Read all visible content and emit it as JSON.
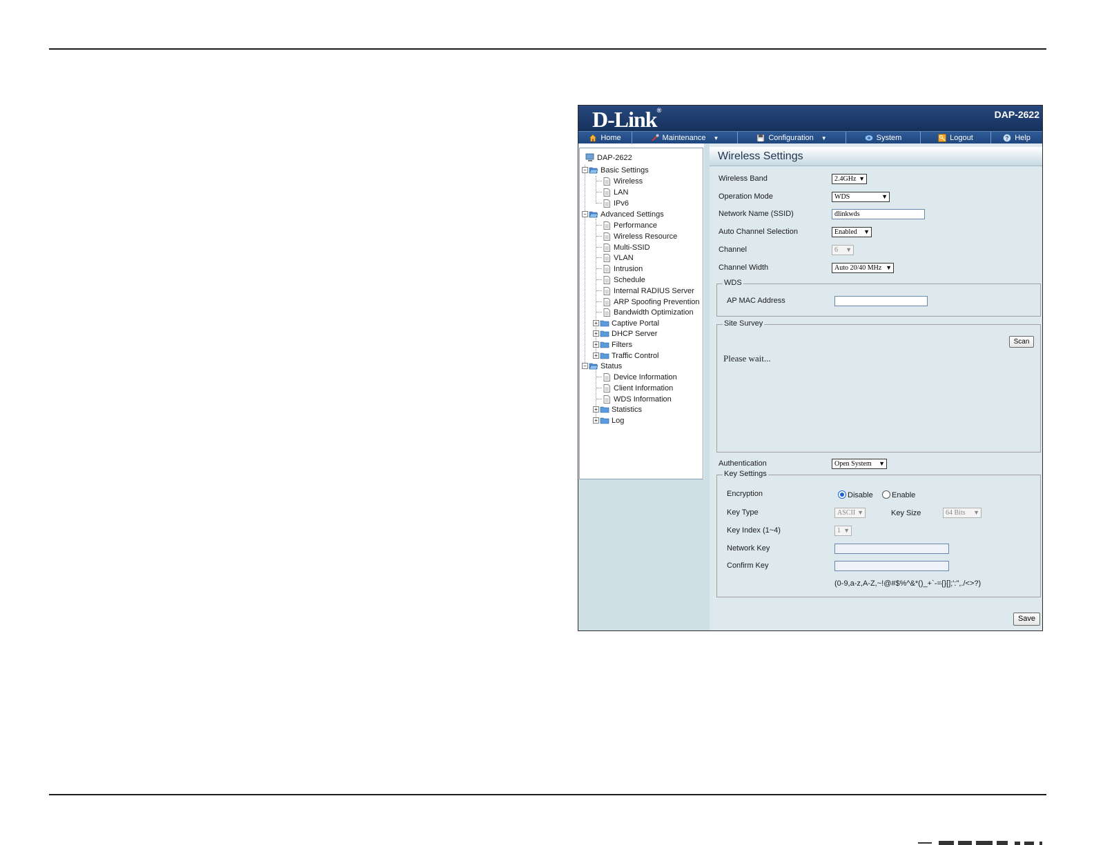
{
  "banner": {
    "logo_text": "D-Link",
    "logo_mark": "®",
    "model": "DAP-2622"
  },
  "nav": [
    {
      "label": "Home",
      "icon": "home-icon"
    },
    {
      "label": "Maintenance",
      "icon": "tools-icon"
    },
    {
      "label": "Configuration",
      "icon": "disk-icon"
    },
    {
      "label": "System",
      "icon": "system-icon"
    },
    {
      "label": "Logout",
      "icon": "key-icon"
    },
    {
      "label": "Help",
      "icon": "help-icon"
    }
  ],
  "tree": {
    "root": "DAP-2622",
    "basic": {
      "label": "Basic Settings",
      "items": [
        "Wireless",
        "LAN",
        "IPv6"
      ]
    },
    "advanced": {
      "label": "Advanced Settings",
      "items": [
        "Performance",
        "Wireless Resource",
        "Multi-SSID",
        "VLAN",
        "Intrusion",
        "Schedule",
        "Internal RADIUS Server",
        "ARP Spoofing Prevention",
        "Bandwidth Optimization"
      ],
      "folders": [
        "Captive Portal",
        "DHCP Server",
        "Filters",
        "Traffic Control"
      ]
    },
    "status": {
      "label": "Status",
      "items": [
        "Device Information",
        "Client Information",
        "WDS Information"
      ],
      "folders": [
        "Statistics",
        "Log"
      ]
    }
  },
  "content": {
    "title": "Wireless Settings",
    "wireless_band": {
      "label": "Wireless Band",
      "value": "2.4GHz"
    },
    "operation_mode": {
      "label": "Operation Mode",
      "value": "WDS"
    },
    "ssid": {
      "label": "Network Name (SSID)",
      "value": "dlinkwds"
    },
    "auto_channel": {
      "label": "Auto Channel Selection",
      "value": "Enabled"
    },
    "channel": {
      "label": "Channel",
      "value": "6"
    },
    "channel_width": {
      "label": "Channel Width",
      "value": "Auto 20/40 MHz"
    },
    "wds": {
      "legend": "WDS",
      "ap_mac_label": "AP MAC Address",
      "ap_mac_value": ""
    },
    "site_survey": {
      "legend": "Site Survey",
      "scan_label": "Scan",
      "status_text": "Please wait..."
    },
    "authentication": {
      "label": "Authentication",
      "value": "Open System"
    },
    "key_settings": {
      "legend": "Key Settings",
      "encryption_label": "Encryption",
      "disable_label": "Disable",
      "enable_label": "Enable",
      "encryption_selected": "Disable",
      "key_type_label": "Key Type",
      "key_type_value": "ASCII",
      "key_size_label": "Key Size",
      "key_size_value": "64 Bits",
      "key_index_label": "Key Index (1~4)",
      "key_index_value": "1",
      "network_key_label": "Network Key",
      "network_key_value": "",
      "confirm_key_label": "Confirm Key",
      "confirm_key_value": "",
      "hint": "(0-9,a-z,A-Z,~!@#$%^&*()_+`-={}[];':\",./<>?)"
    },
    "save_label": "Save"
  }
}
